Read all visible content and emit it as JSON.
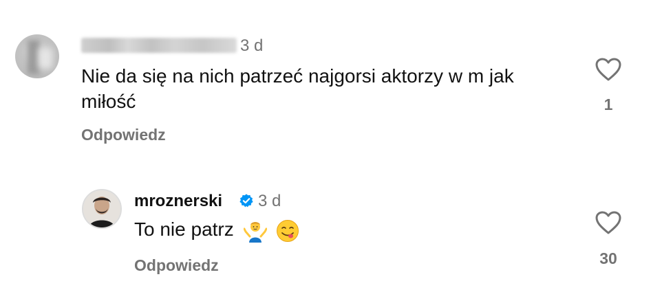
{
  "comments": [
    {
      "username": "",
      "time": "3 d",
      "text": "Nie da się na nich patrzeć najgorsi aktorzy w m jak miłość",
      "reply_label": "Odpowiedz",
      "like_count": "1"
    },
    {
      "username": "mroznerski",
      "verified": true,
      "time": "3 d",
      "text": "To nie patrz",
      "emojis": [
        "person-shrugging-emoji",
        "face-savoring-food-emoji"
      ],
      "reply_label": "Odpowiedz",
      "like_count": "30"
    }
  ],
  "colors": {
    "text": "#111111",
    "secondary": "#737373",
    "verified": "#0095f6"
  }
}
